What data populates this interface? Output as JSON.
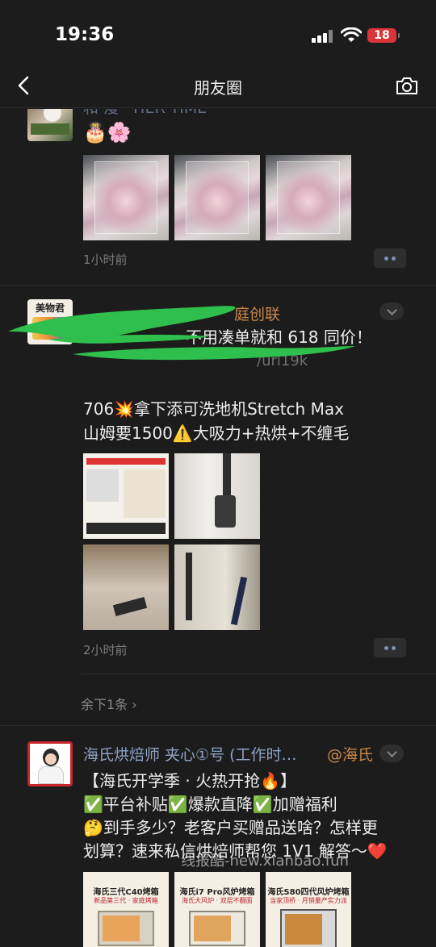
{
  "status_bar": {
    "time": "19:36",
    "battery": "18"
  },
  "nav": {
    "title": "朋友圈"
  },
  "post1": {
    "name_partial": "和 漫 · HER TIME",
    "text": "🎂🌸",
    "time": "1小时前"
  },
  "post2": {
    "avatar_text": "美物君",
    "name_partial": "庭创联",
    "line1": "不用凑单就和 618 同价！",
    "line2_partial": "/url19k",
    "line3": "706💥拿下添可洗地机Stretch Max",
    "line4": "山姆要1500⚠️大吸力+热烘+不缠毛",
    "time": "2小时前",
    "remaining": "余下1条 ›"
  },
  "post3": {
    "name": "海氏烘焙师 夹心①号 (工作时…",
    "mention": "@海氏",
    "line1": "【海氏开学季 · 火热开抢🔥】",
    "line2": "✅平台补贴✅爆款直降✅加赠福利",
    "line3": "🤔到手多少？老客户买赠品送啥？怎样更",
    "line4": "划算？速来私信烘焙师帮您 1V1 解答～❤️",
    "thumbs": [
      {
        "title": "海氏三代C40烤箱",
        "sub": "新品第三代 · 家庭烤箱"
      },
      {
        "title": "海氏i7 Pro风炉烤箱",
        "sub": "海氏大风炉 · 双层不翻面"
      },
      {
        "title": "海氏S80四代风炉烤箱",
        "sub": "当家顶桥 · 月销量产实力派"
      }
    ]
  },
  "watermark": "线报酷-new.xianbao.fun",
  "colors": {
    "name_blue": "#8ea3c7",
    "mention_orange": "#c9884a",
    "brush_green": "#2fbf4c",
    "battery_red": "#d9353a"
  }
}
